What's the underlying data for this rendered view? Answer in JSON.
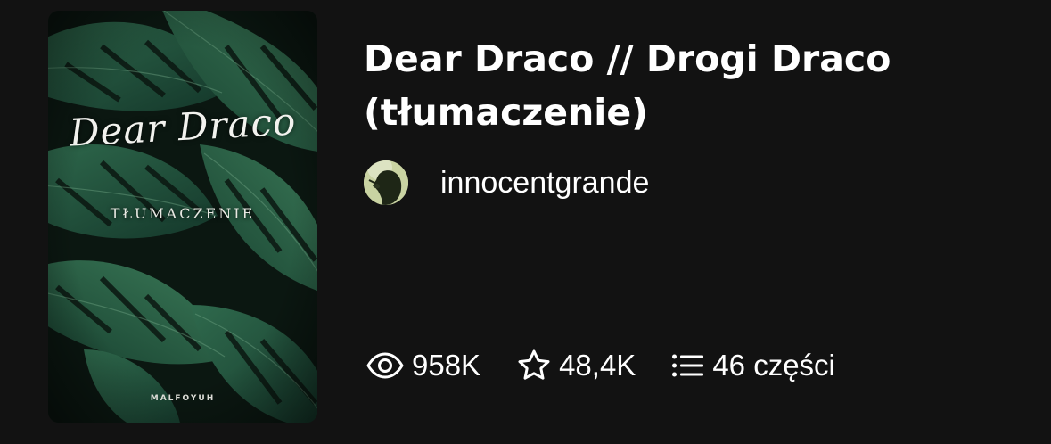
{
  "story": {
    "title": "Dear Draco // Drogi Draco (tłumaczenie)",
    "author": "innocentgrande"
  },
  "cover": {
    "title": "Dear Draco",
    "subtitle": "TŁUMACZENIE",
    "author": "MALFOYUH"
  },
  "stats": {
    "reads": "958K",
    "votes": "48,4K",
    "parts": "46 części"
  },
  "icons": {
    "reads": "eye-icon",
    "votes": "star-icon",
    "parts": "list-icon"
  },
  "colors": {
    "background": "#121212",
    "text": "#ffffff",
    "cover_leaf": "#1f4a36"
  }
}
